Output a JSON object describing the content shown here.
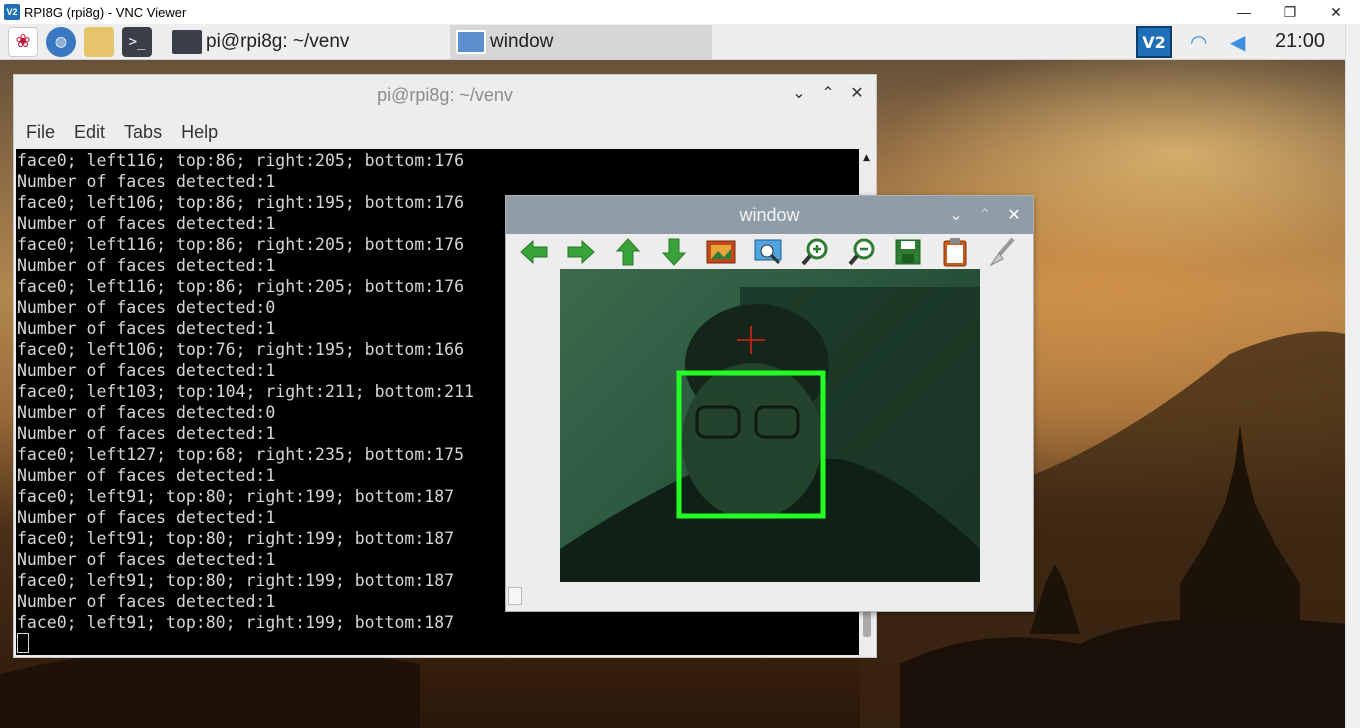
{
  "vnc": {
    "title": "RPI8G (rpi8g) - VNC Viewer",
    "logo_text": "V2",
    "minimize": "—",
    "restore": "❐",
    "close": "✕"
  },
  "taskbar": {
    "tasks": [
      {
        "label": "pi@rpi8g: ~/venv"
      },
      {
        "label": "window"
      }
    ],
    "vnc_tray_text": "V2",
    "clock": "21:00"
  },
  "terminal": {
    "title": "pi@rpi8g: ~/venv",
    "menu": [
      "File",
      "Edit",
      "Tabs",
      "Help"
    ],
    "lines": [
      "face0; left116; top:86; right:205; bottom:176",
      "Number of faces detected:1",
      "face0; left106; top:86; right:195; bottom:176",
      "Number of faces detected:1",
      "face0; left116; top:86; right:205; bottom:176",
      "Number of faces detected:1",
      "face0; left116; top:86; right:205; bottom:176",
      "Number of faces detected:0",
      "Number of faces detected:1",
      "face0; left106; top:76; right:195; bottom:166",
      "Number of faces detected:1",
      "face0; left103; top:104; right:211; bottom:211",
      "Number of faces detected:0",
      "Number of faces detected:1",
      "face0; left127; top:68; right:235; bottom:175",
      "Number of faces detected:1",
      "face0; left91; top:80; right:199; bottom:187",
      "Number of faces detected:1",
      "face0; left91; top:80; right:199; bottom:187",
      "Number of faces detected:1",
      "face0; left91; top:80; right:199; bottom:187",
      "Number of faces detected:1",
      "face0; left91; top:80; right:199; bottom:187"
    ]
  },
  "cv_window": {
    "title": "window",
    "tools": [
      "arrow-left-icon",
      "arrow-right-icon",
      "arrow-up-icon",
      "arrow-down-icon",
      "image-icon",
      "zoom-fit-icon",
      "zoom-in-icon",
      "zoom-out-icon",
      "save-icon",
      "clipboard-icon",
      "brush-icon"
    ]
  },
  "colors": {
    "face_box": "#22ff22",
    "crosshair": "#e0201a",
    "cv_title_bar": "#8f9da8"
  }
}
